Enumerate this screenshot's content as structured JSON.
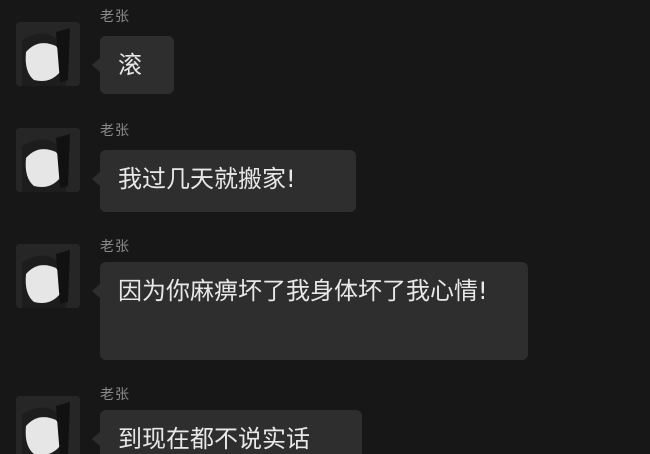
{
  "messages": [
    {
      "sender": "老张",
      "text": "滚"
    },
    {
      "sender": "老张",
      "text": "我过几天就搬家!"
    },
    {
      "sender": "老张",
      "text": "因为你麻痹坏了我身体坏了我心情!"
    },
    {
      "sender": "老张",
      "text": "到现在都不说实话"
    }
  ],
  "avatar": {
    "icon": "profile-photo-icon",
    "color": "#e6e6e6"
  }
}
